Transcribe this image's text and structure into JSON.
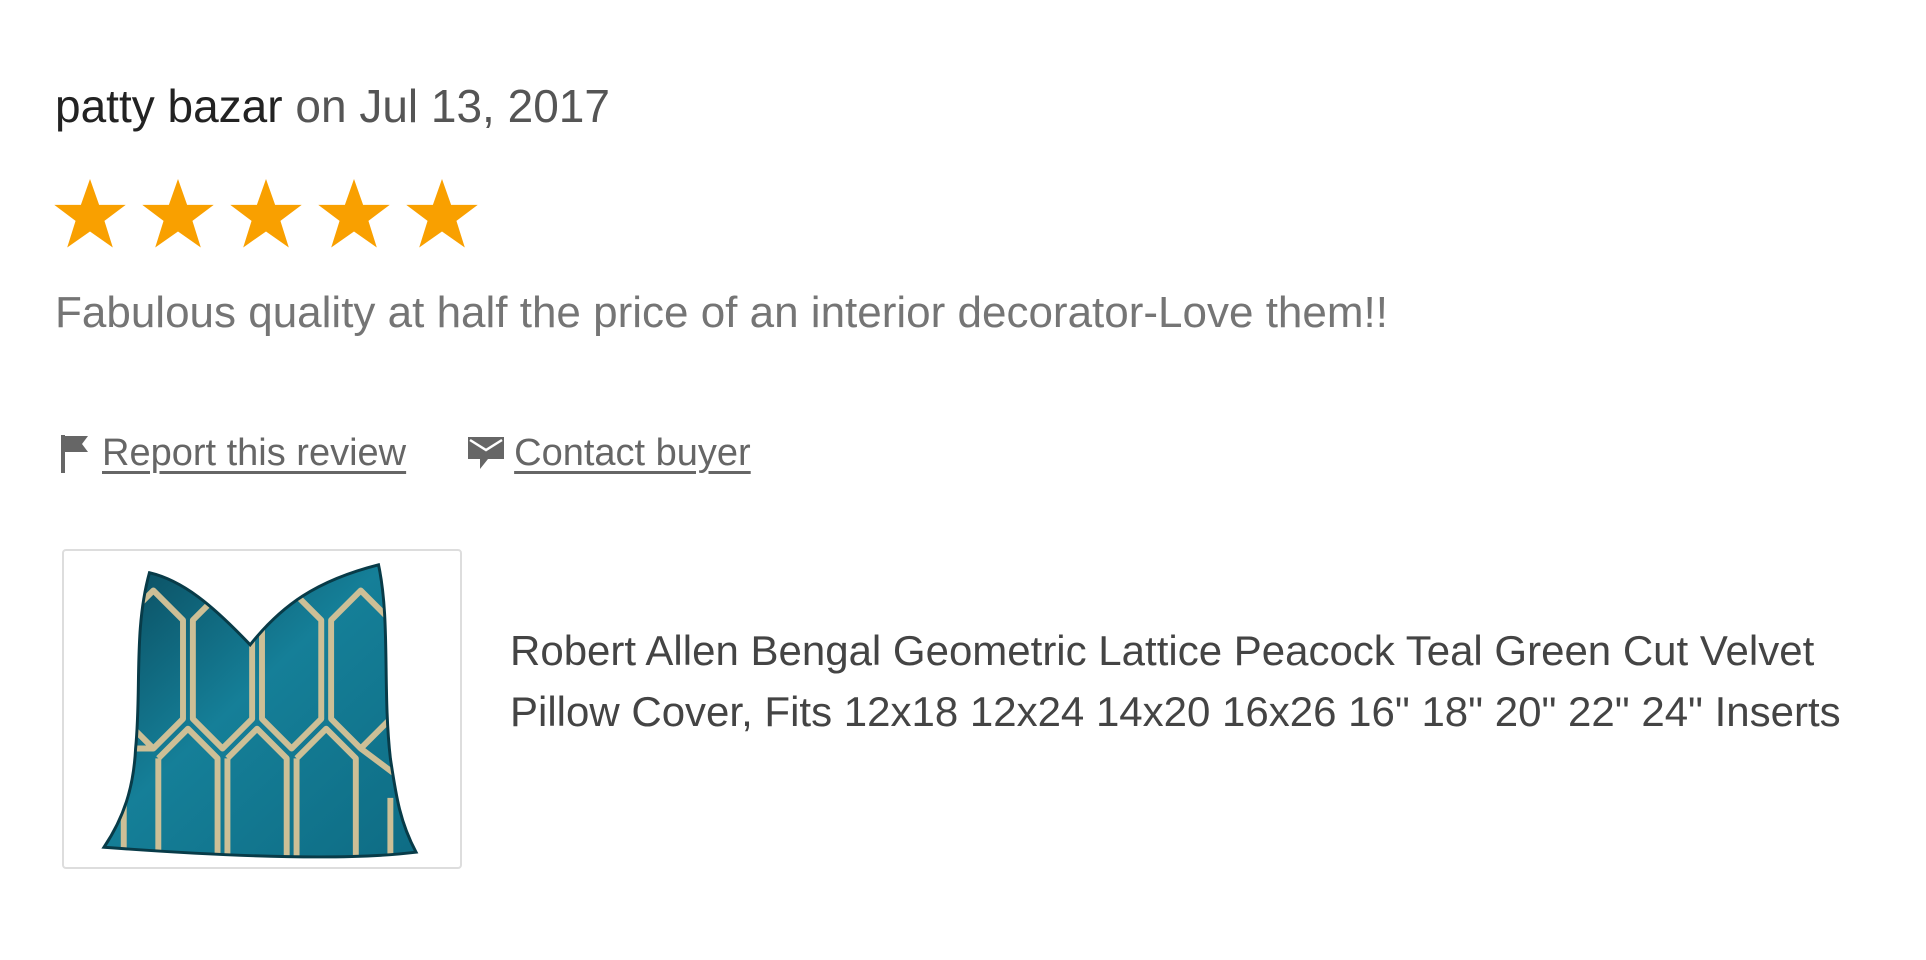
{
  "review": {
    "reviewer_name": "patty bazar",
    "date_prefix": "on",
    "date": "Jul 13, 2017",
    "rating": 5,
    "rating_max": 5,
    "star_color": "#F9A000",
    "text": "Fabulous quality at half the price of an interior decorator-Love them!!"
  },
  "actions": {
    "report_label": "Report this review",
    "report_icon": "flag-icon",
    "contact_label": "Contact buyer",
    "contact_icon": "envelope-icon"
  },
  "product": {
    "image_icon": "teal-geometric-pillow-image",
    "title": "Robert Allen Bengal Geometric Lattice Peacock Teal Green Cut Velvet Pillow Cover, Fits 12x18 12x24 14x20 16x26 16\" 18\" 20\" 22\" 24\" Inserts"
  }
}
